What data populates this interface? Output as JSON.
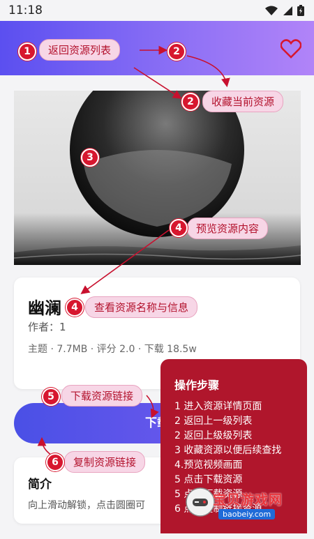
{
  "status_bar": {
    "time": "11:18"
  },
  "header": {
    "favorite_icon": "heart-icon"
  },
  "annotations": {
    "back": "返回资源列表",
    "favorite": "收藏当前资源",
    "preview": "预览资源内容",
    "info": "查看资源名称与信息",
    "download_link": "下载资源链接",
    "copy_link": "复制资源链接"
  },
  "badges": {
    "b1": "1",
    "b2a": "2",
    "b2b": "2",
    "b3": "3",
    "b4a": "4",
    "b4b": "4",
    "b5": "5",
    "b6": "6"
  },
  "resource": {
    "title": "幽澜",
    "author": "作者：1",
    "meta": "主题 · 7.7MB · 评分 2.0 · 下载 18.5w"
  },
  "download": {
    "label": "下载"
  },
  "intro": {
    "heading": "简介",
    "text": "向上滑动解锁，点击圆圈可"
  },
  "steps": {
    "heading": "操作步骤",
    "items": [
      "1 进入资源详情页面",
      "2 返回上一级列表",
      "2 返回上级级列表",
      "3 收藏资源以便后续查找",
      "4.预览视频画面",
      "5 点击下载资源",
      "5 点击下载资源",
      "6 点击复制链接资源"
    ]
  },
  "watermark": {
    "text": "宝贝游戏网",
    "url": "baobeiy.com"
  },
  "colors": {
    "accent": "#d7172f",
    "header_start": "#5b4ff0",
    "header_end": "#b184f8",
    "steps_bg": "#b0162c"
  }
}
